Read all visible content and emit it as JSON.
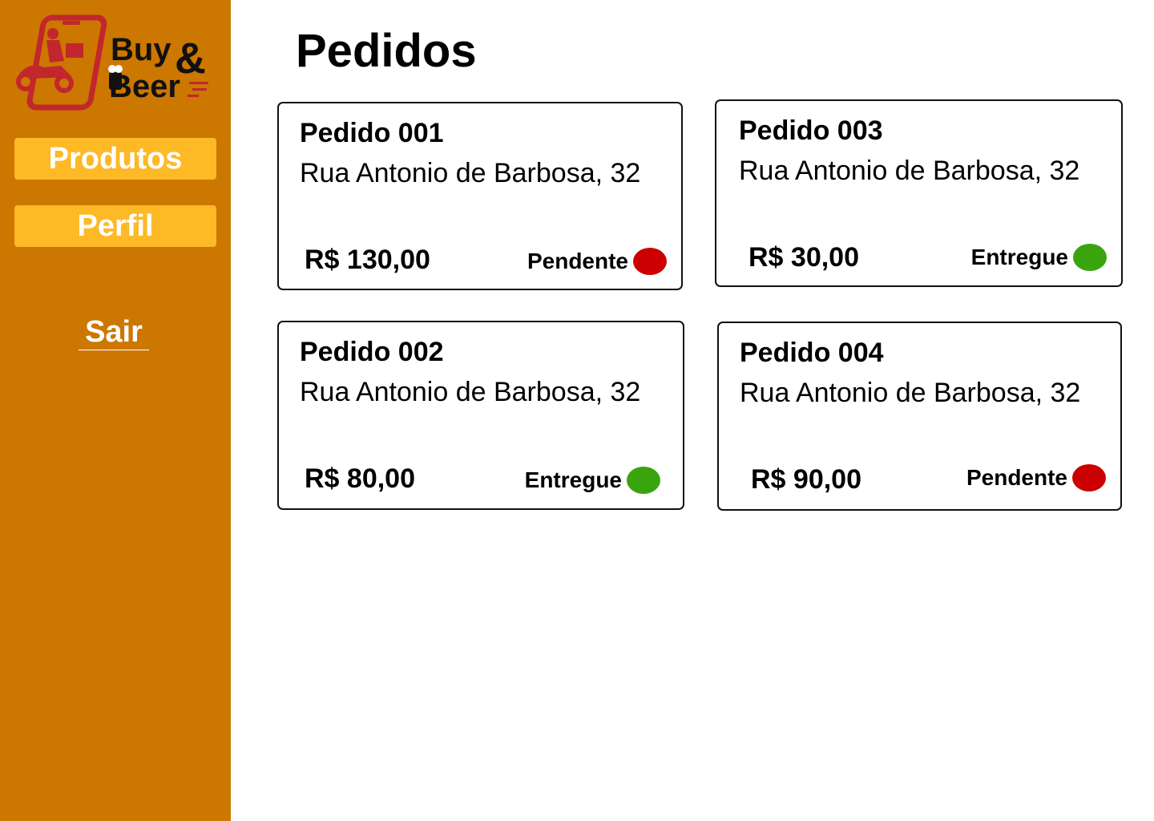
{
  "sidebar": {
    "logo": {
      "word1": "Buy",
      "ampersand": "&",
      "word2": "Beer",
      "icon": "delivery-scooter-phone-icon",
      "colors": {
        "primary": "#c1272d",
        "text": "#111111"
      }
    },
    "nav": {
      "produtos": "Produtos",
      "perfil": "Perfil",
      "sair": "Sair"
    },
    "colors": {
      "background": "#cc7700",
      "button": "#fdb926"
    }
  },
  "main": {
    "title": "Pedidos",
    "orders": [
      {
        "title": "Pedido 001",
        "address": "Rua Antonio de Barbosa, 32",
        "price": "R$ 130,00",
        "status": "Pendente",
        "status_color": "#cc0000"
      },
      {
        "title": "Pedido 003",
        "address": "Rua Antonio de Barbosa, 32",
        "price": "R$ 30,00",
        "status": "Entregue",
        "status_color": "#3aa40e"
      },
      {
        "title": "Pedido 002",
        "address": "Rua Antonio de Barbosa, 32",
        "price": "R$ 80,00",
        "status": "Entregue",
        "status_color": "#3aa40e"
      },
      {
        "title": "Pedido 004",
        "address": "Rua Antonio de Barbosa, 32",
        "price": "R$ 90,00",
        "status": "Pendente",
        "status_color": "#cc0000"
      }
    ]
  }
}
